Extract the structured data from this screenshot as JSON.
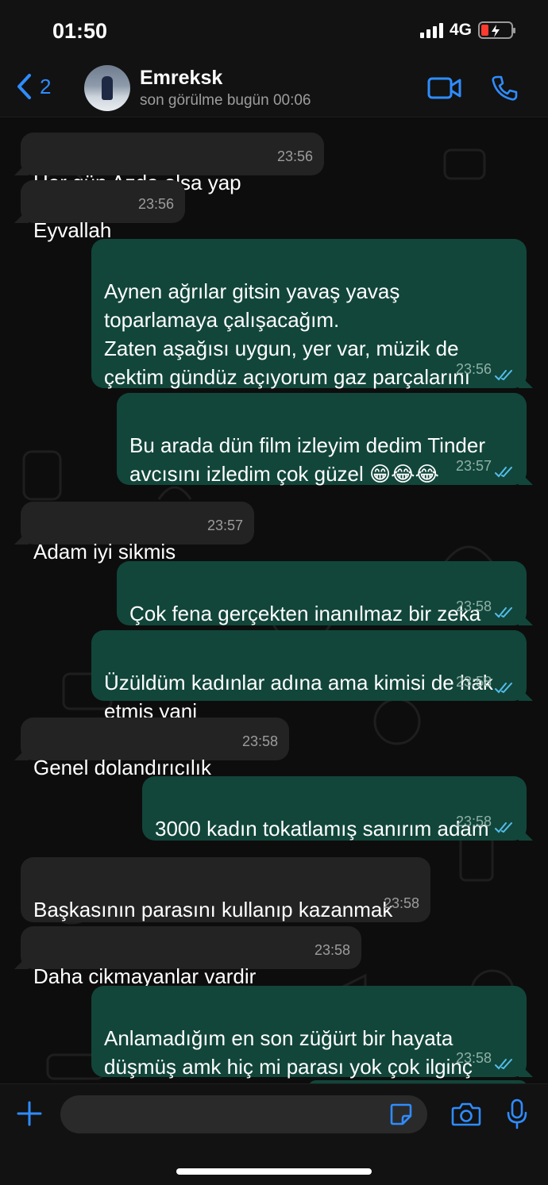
{
  "status_bar": {
    "time": "01:50",
    "network": "4G"
  },
  "header": {
    "back_count": "2",
    "contact_name": "Emreksk",
    "last_seen": "son görülme bugün 00:06"
  },
  "messages": [
    {
      "direction": "in",
      "text": "Her gün Azda olsa yap",
      "time": "23:56"
    },
    {
      "direction": "in",
      "text": "Eyvallah",
      "time": "23:56"
    },
    {
      "direction": "out",
      "text": "Aynen ağrılar gitsin yavaş yavaş\ntoparlamaya çalışacağım.\nZaten aşağısı uygun, yer var, müzik de\nçektim gündüz açıyorum gaz parçalarını",
      "time": "23:56"
    },
    {
      "direction": "out",
      "text": "Bu arada dün film izleyim dedim Tinder\navcısını izledim çok güzel 😁😂😂",
      "time": "23:57"
    },
    {
      "direction": "in",
      "text": "Adam iyi sikmis",
      "time": "23:57"
    },
    {
      "direction": "out",
      "text": "Çok fena gerçekten inanılmaz bir zeka",
      "time": "23:58"
    },
    {
      "direction": "out",
      "text": "Üzüldüm kadınlar adına ama kimisi de hak\netmiş yani",
      "time": "23:58"
    },
    {
      "direction": "in",
      "text": "Genel dolandırıcılık",
      "time": "23:58"
    },
    {
      "direction": "out",
      "text": "3000 kadın tokatlamış sanırım adam",
      "time": "23:58"
    },
    {
      "direction": "in",
      "text": "Başkasının parasını kullanıp kazanmak",
      "time": "23:58"
    },
    {
      "direction": "in",
      "text": "Daha cikmayanlar vardir",
      "time": "23:58"
    },
    {
      "direction": "out",
      "text": "Anlamadığım en son züğürt bir hayata\ndüşmüş amk hiç mi parası yok çok ilginç",
      "time": "23:58"
    }
  ],
  "input": {
    "placeholder": ""
  },
  "colors": {
    "accent": "#2f8cff",
    "outgoing_bubble": "#12463a",
    "incoming_bubble": "#232323",
    "read_check": "#53bdeb"
  }
}
